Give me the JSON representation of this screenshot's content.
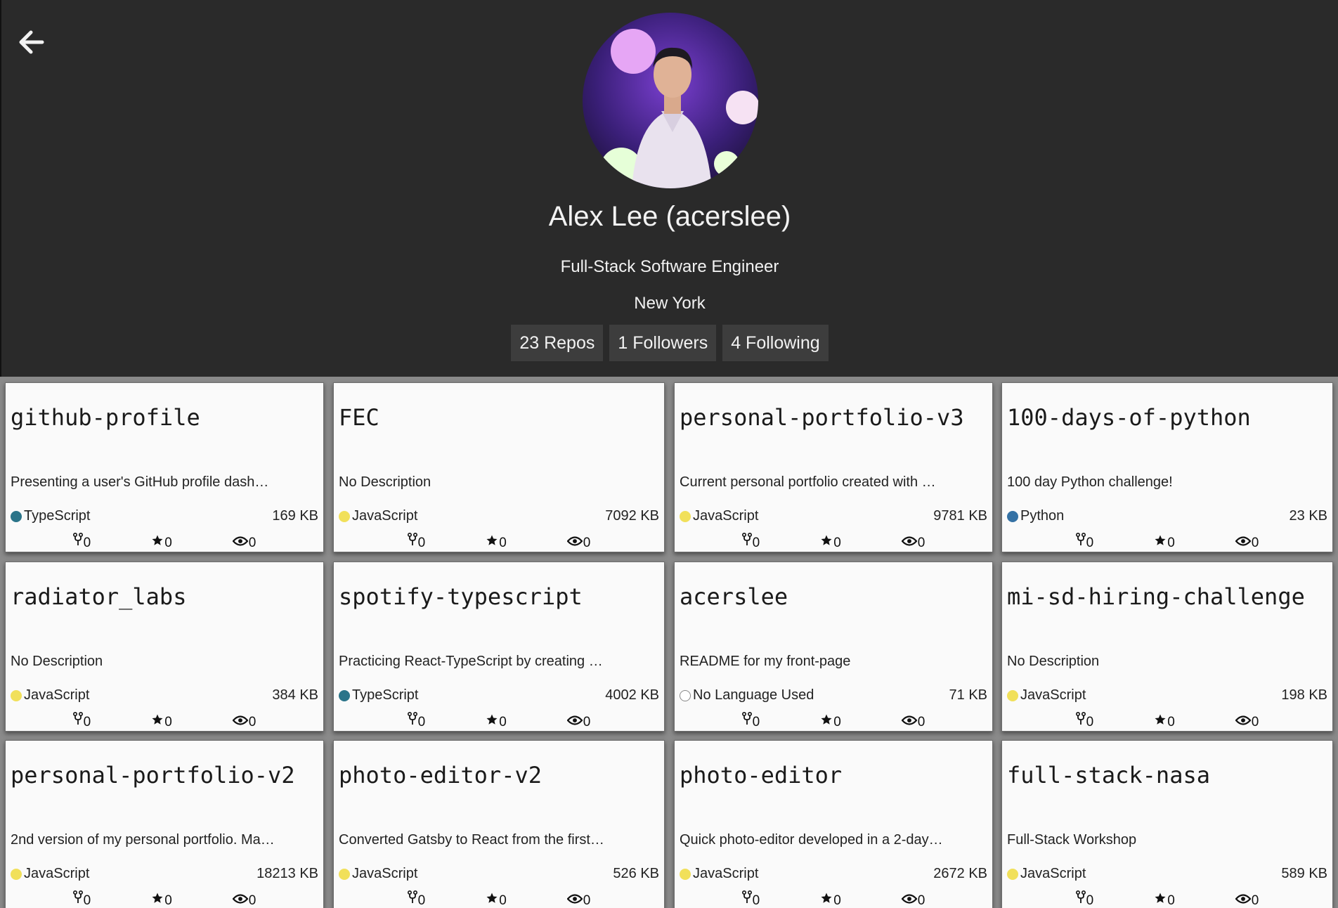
{
  "profile": {
    "name": "Alex Lee (acerslee)",
    "title": "Full-Stack Software Engineer",
    "location": "New York",
    "stats": {
      "repos": "23 Repos",
      "followers": "1 Followers",
      "following": "4 Following"
    }
  },
  "colors": {
    "header_bg": "#2a2a2a",
    "grid_bg": "#8a8a8a",
    "card_bg": "#fafafa",
    "TypeScript": "#2b7489",
    "JavaScript": "#f1e05a",
    "Python": "#3572A5",
    "none": "#ffffff"
  },
  "repos": [
    {
      "name": "github-profile",
      "description": "Presenting a user's GitHub profile dash…",
      "language": "TypeScript",
      "size": "169 KB",
      "forks": "0",
      "stars": "0",
      "watchers": "0"
    },
    {
      "name": "FEC",
      "description": "No Description",
      "language": "JavaScript",
      "size": "7092 KB",
      "forks": "0",
      "stars": "0",
      "watchers": "0"
    },
    {
      "name": "personal-portfolio-v3",
      "description": "Current personal portfolio created with …",
      "language": "JavaScript",
      "size": "9781 KB",
      "forks": "0",
      "stars": "0",
      "watchers": "0"
    },
    {
      "name": "100-days-of-python",
      "description": "100 day Python challenge!",
      "language": "Python",
      "size": "23 KB",
      "forks": "0",
      "stars": "0",
      "watchers": "0"
    },
    {
      "name": "radiator_labs",
      "description": "No Description",
      "language": "JavaScript",
      "size": "384 KB",
      "forks": "0",
      "stars": "0",
      "watchers": "0"
    },
    {
      "name": "spotify-typescript",
      "description": "Practicing React-TypeScript by creating …",
      "language": "TypeScript",
      "size": "4002 KB",
      "forks": "0",
      "stars": "0",
      "watchers": "0"
    },
    {
      "name": "acerslee",
      "description": "README for my front-page",
      "language": "No Language Used",
      "size": "71 KB",
      "forks": "0",
      "stars": "0",
      "watchers": "0"
    },
    {
      "name": "mi-sd-hiring-challenge",
      "description": "No Description",
      "language": "JavaScript",
      "size": "198 KB",
      "forks": "0",
      "stars": "0",
      "watchers": "0"
    },
    {
      "name": "personal-portfolio-v2",
      "description": "2nd version of my personal portfolio. Ma…",
      "language": "JavaScript",
      "size": "18213 KB",
      "forks": "0",
      "stars": "0",
      "watchers": "0"
    },
    {
      "name": "photo-editor-v2",
      "description": "Converted Gatsby to React from the first…",
      "language": "JavaScript",
      "size": "526 KB",
      "forks": "0",
      "stars": "0",
      "watchers": "0"
    },
    {
      "name": "photo-editor",
      "description": "Quick photo-editor developed in a 2-day…",
      "language": "JavaScript",
      "size": "2672 KB",
      "forks": "0",
      "stars": "0",
      "watchers": "0"
    },
    {
      "name": "full-stack-nasa",
      "description": "Full-Stack Workshop",
      "language": "JavaScript",
      "size": "589 KB",
      "forks": "0",
      "stars": "0",
      "watchers": "0"
    }
  ]
}
